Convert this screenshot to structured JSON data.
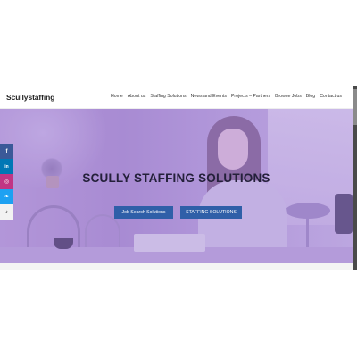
{
  "brand": {
    "logo": "Scullystaffing"
  },
  "nav": {
    "items": [
      {
        "label": "Home"
      },
      {
        "label": "About us"
      },
      {
        "label": "Staffing Solutions"
      },
      {
        "label": "News and Events"
      },
      {
        "label": "Projects – Partners"
      },
      {
        "label": "Browse Jobs"
      },
      {
        "label": "Blog"
      },
      {
        "label": "Contact us"
      }
    ]
  },
  "hero": {
    "title": "SCULLY STAFFING SOLUTIONS",
    "buttons": [
      {
        "label": "Job Search Solutions"
      },
      {
        "label": "STAFFING SOLUTIONS"
      }
    ]
  },
  "social": [
    {
      "icon": "facebook-icon",
      "glyph": "f",
      "color": "#3b5998"
    },
    {
      "icon": "linkedin-icon",
      "glyph": "in",
      "color": "#0077b5"
    },
    {
      "icon": "instagram-icon",
      "glyph": "◎",
      "color": "#c13584"
    },
    {
      "icon": "twitter-icon",
      "glyph": "❧",
      "color": "#1da1f2"
    },
    {
      "icon": "tiktok-icon",
      "glyph": "♪",
      "color": "#f2f2f2"
    }
  ],
  "colors": {
    "accent": "#2f5fa8",
    "hero_tint": "#b29ad9"
  }
}
